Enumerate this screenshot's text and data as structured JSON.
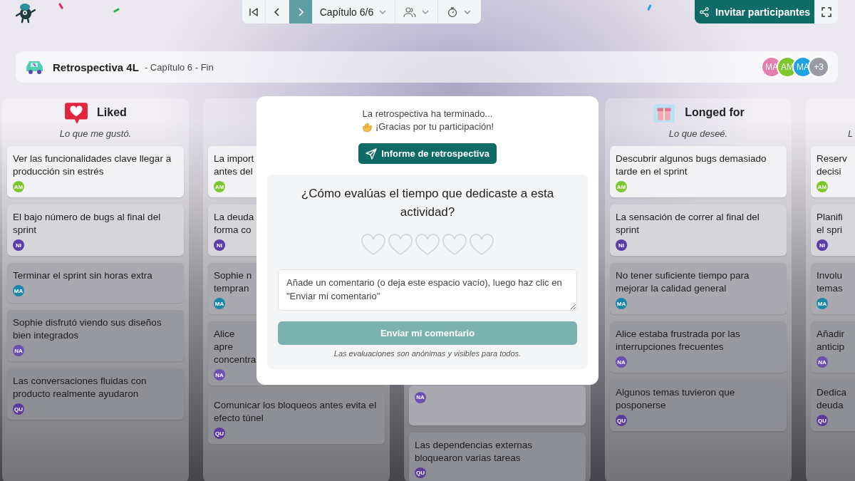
{
  "toolbar": {
    "buttons": [
      {
        "kind": "first",
        "selected": false
      },
      {
        "kind": "prev",
        "selected": false
      },
      {
        "kind": "next",
        "selected": true
      }
    ],
    "chapter": "Capítulo 6/6",
    "invite": "Invitar participantes"
  },
  "header": {
    "title": "Retrospectiva 4L",
    "subtitle": "- Capítulo 6 - Fin",
    "participants": [
      {
        "initials": "MA",
        "color": "#e47fae"
      },
      {
        "initials": "AM",
        "color": "#7cc72e"
      },
      {
        "initials": "MA",
        "color": "#1fa3e3"
      },
      {
        "initials": "+3",
        "color": "#9a9ca4"
      }
    ]
  },
  "columns": [
    {
      "title": "Liked",
      "subtitle": "Lo que me gustó.",
      "kind": "heart",
      "cards": [
        {
          "text": "Ver las funcionalidades clave llegar a producción sin estrés",
          "author": "AM",
          "color": "#7cc72e"
        },
        {
          "text": "El bajo número de bugs al final del sprint",
          "author": "NI",
          "color": "#5a3ea6"
        },
        {
          "text": "Terminar el sprint sin horas extra",
          "author": "MA",
          "color": "#1a86a8"
        },
        {
          "text": "Sophie disfrutó viendo sus diseños bien integrados",
          "author": "NA",
          "color": "#6b4fb5"
        },
        {
          "text": "Las conversaciones fluidas con producto realmente ayudaron",
          "author": "QU",
          "color": "#5b3a9c"
        }
      ]
    },
    {
      "cards": [
        {
          "text": "La import antes del",
          "author": "AM",
          "color": "#7cc72e"
        },
        {
          "text": "La deuda forma co",
          "author": "NI",
          "color": "#5a3ea6"
        },
        {
          "text": "Sophie n tempran",
          "author": "MA",
          "color": "#1a86a8"
        },
        {
          "text": "Alice apre concentra",
          "author": "NA",
          "color": "#6b4fb5"
        },
        {
          "text": "Comunicar los bloqueos antes evita el efecto túnel",
          "author": "QU",
          "color": "#5b3a9c"
        }
      ]
    },
    {
      "cards": [
        {
          "author": "NA",
          "color": "#6b4fb5"
        },
        {
          "text": "Las dependencias externas bloquearon varias tareas",
          "author": "QU",
          "color": "#5b3a9c"
        }
      ]
    },
    {
      "title": "Longed for",
      "subtitle": "Lo que deseé.",
      "kind": "gift",
      "cards": [
        {
          "text": "Descubrir algunos bugs demasiado tarde en el sprint",
          "author": "AM",
          "color": "#7cc72e"
        },
        {
          "text": "La sensación de correr al final del sprint",
          "author": "NI",
          "color": "#5a3ea6"
        },
        {
          "text": "No tener suficiente tiempo para mejorar la calidad general",
          "author": "MA",
          "color": "#1a86a8"
        },
        {
          "text": "Alice estaba frustrada por las interrupciones frecuentes",
          "author": "NA",
          "color": "#6b4fb5"
        },
        {
          "text": "Algunos temas tuvieron que posponerse",
          "author": "QU",
          "color": "#5b3a9c"
        }
      ]
    },
    {
      "subtitle": "L",
      "cards": [
        {
          "text": "Reserv decisi",
          "author": "AM",
          "color": "#7cc72e"
        },
        {
          "text": "Planifi el spri",
          "author": "NI",
          "color": "#5a3ea6"
        },
        {
          "text": "Involu temas",
          "author": "MA",
          "color": "#1a86a8"
        },
        {
          "text": "Añadir anticip",
          "author": "NA",
          "color": "#6b4fb5"
        },
        {
          "text": "Dedica deuda",
          "author": "QU",
          "color": "#5b3a9c"
        }
      ]
    }
  ],
  "modal": {
    "line1": "La retrospectiva ha terminado...",
    "line2": "¡Gracias por tu participación!",
    "report_button": "Informe de retrospectiva",
    "question": "¿Cómo evalúas el tiempo que dedicaste a esta actividad?",
    "rating": {
      "stars": 0
    },
    "comment": {
      "placeholder": "Añade un comentario (o deja este espacio vacío), luego haz clic en \"Enviar mi comentario\""
    },
    "submit": {
      "label": "Enviar mi comentario",
      "disabled": true
    },
    "note": "Las evaluaciones son anónimas y visibles para todos."
  }
}
